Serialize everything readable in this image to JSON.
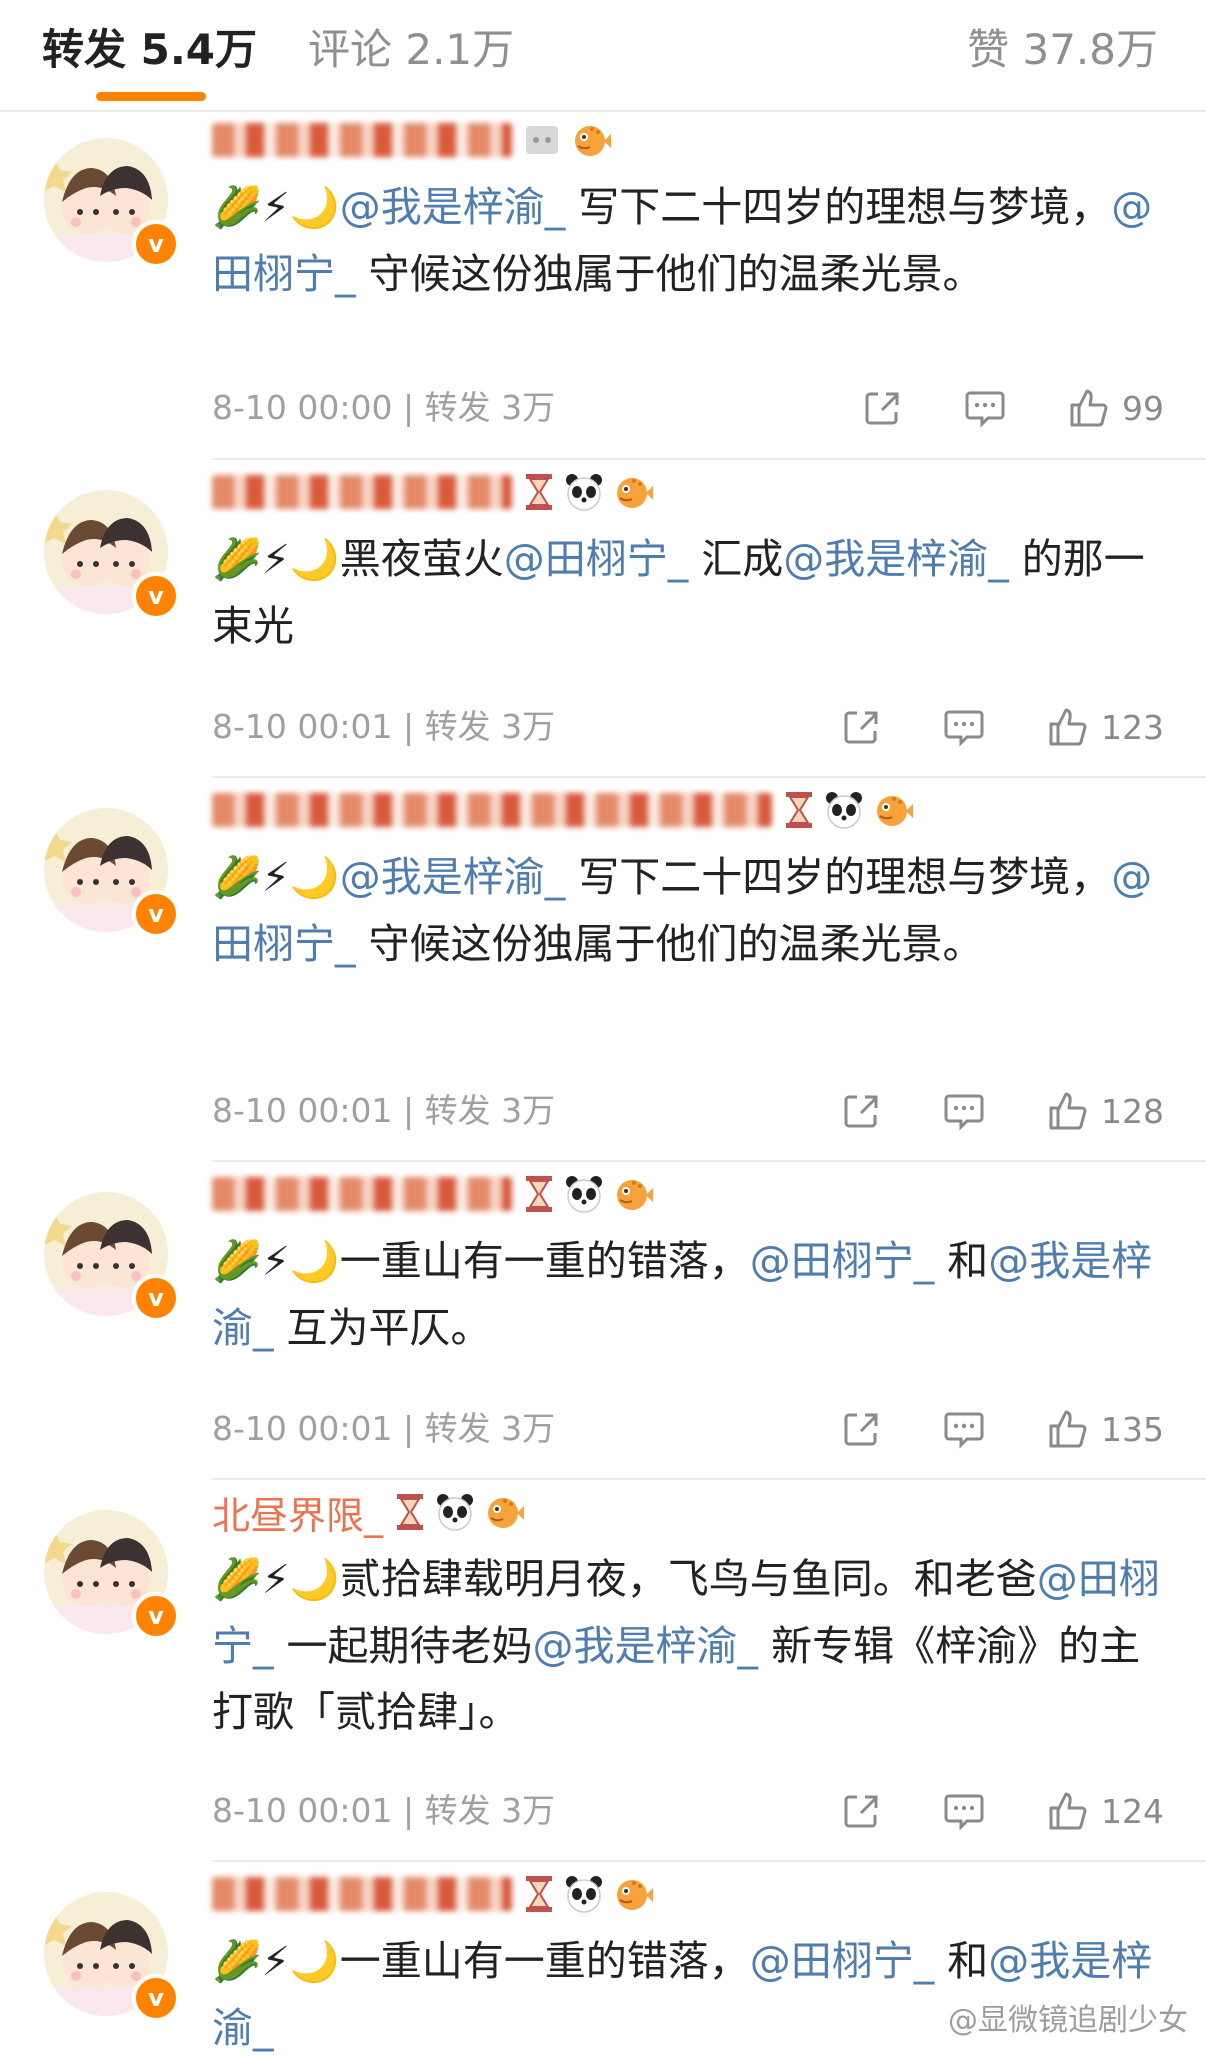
{
  "tabs": {
    "repost": "转发 5.4万",
    "comment": "评论 2.1万",
    "like": "赞 37.8万"
  },
  "colors": {
    "accent": "#ff8200",
    "mention": "#507daf",
    "username": "#eb7350"
  },
  "icons": [
    "share-icon",
    "comment-icon",
    "like-icon",
    "verified-badge-icon",
    "hourglass-icon",
    "panda-icon",
    "pufferfish-icon",
    "corn-icon",
    "lightning-icon",
    "crescent-moon-icon"
  ],
  "posts": [
    {
      "username": "",
      "username_obscured": true,
      "emoji": "🌽⚡🌙",
      "segments": [
        {
          "t": "@我是梓渝_",
          "m": true
        },
        {
          "t": " 写下二十四岁的理想与梦境，",
          "m": false
        },
        {
          "t": "@田栩宁_",
          "m": true
        },
        {
          "t": " 守候这份独属于他们的温柔光景。",
          "m": false
        }
      ],
      "time": "8-10 00:00",
      "repost_label": "转发 3万",
      "likes": "99"
    },
    {
      "username": "",
      "username_obscured": true,
      "emoji": "🌽⚡🌙",
      "segments": [
        {
          "t": "黑夜萤火",
          "m": false
        },
        {
          "t": "@田栩宁_",
          "m": true
        },
        {
          "t": " 汇成",
          "m": false
        },
        {
          "t": "@我是梓渝_",
          "m": true
        },
        {
          "t": " 的那一束光",
          "m": false
        }
      ],
      "time": "8-10 00:01",
      "repost_label": "转发 3万",
      "likes": "123"
    },
    {
      "username": "",
      "username_obscured": true,
      "emoji": "🌽⚡🌙",
      "segments": [
        {
          "t": "@我是梓渝_",
          "m": true
        },
        {
          "t": " 写下二十四岁的理想与梦境，",
          "m": false
        },
        {
          "t": "@田栩宁_",
          "m": true
        },
        {
          "t": " 守候这份独属于他们的温柔光景。",
          "m": false
        }
      ],
      "time": "8-10 00:01",
      "repost_label": "转发 3万",
      "likes": "128"
    },
    {
      "username": "",
      "username_obscured": true,
      "emoji": "🌽⚡🌙",
      "segments": [
        {
          "t": "一重山有一重的错落，",
          "m": false
        },
        {
          "t": "@田栩宁_",
          "m": true
        },
        {
          "t": " 和",
          "m": false
        },
        {
          "t": "@我是梓渝_",
          "m": true
        },
        {
          "t": " 互为平仄。",
          "m": false
        }
      ],
      "time": "8-10 00:01",
      "repost_label": "转发 3万",
      "likes": "135"
    },
    {
      "username": "北昼界限_",
      "username_obscured": false,
      "emoji": "🌽⚡🌙",
      "segments": [
        {
          "t": "贰拾肆载明月夜，飞鸟与鱼同。和老爸",
          "m": false
        },
        {
          "t": "@田栩宁_",
          "m": true
        },
        {
          "t": " 一起期待老妈",
          "m": false
        },
        {
          "t": "@我是梓渝_",
          "m": true
        },
        {
          "t": " 新专辑《梓渝》的主打歌「贰拾肆」。",
          "m": false
        }
      ],
      "time": "8-10 00:01",
      "repost_label": "转发 3万",
      "likes": "124"
    },
    {
      "username": "",
      "username_obscured": true,
      "emoji": "🌽⚡🌙",
      "segments": [
        {
          "t": "一重山有一重的错落，",
          "m": false
        },
        {
          "t": "@田栩宁_",
          "m": true
        },
        {
          "t": " 和",
          "m": false
        },
        {
          "t": "@我是梓渝_",
          "m": true
        }
      ],
      "time": "",
      "repost_label": "",
      "likes": ""
    }
  ],
  "watermark": "@显微镜追剧少女"
}
